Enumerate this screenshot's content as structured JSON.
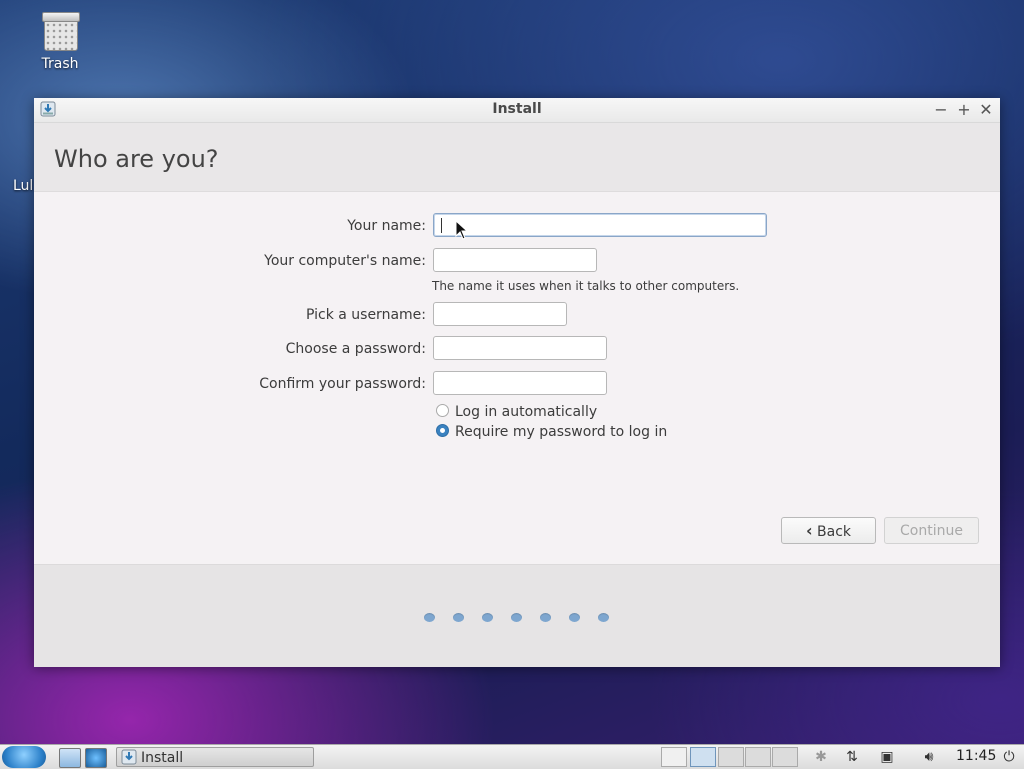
{
  "desktop": {
    "trash_label": "Trash",
    "side_label": "Lul"
  },
  "window": {
    "title": "Install",
    "controls": {
      "minimize": "−",
      "maximize": "+",
      "close": "✕"
    }
  },
  "page": {
    "title": "Who are you?"
  },
  "form": {
    "name": {
      "label": "Your name:",
      "value": ""
    },
    "computer_name": {
      "label": "Your computer's name:",
      "value": "",
      "hint": "The name it uses when it talks to other computers."
    },
    "username": {
      "label": "Pick a username:",
      "value": ""
    },
    "password": {
      "label": "Choose a password:",
      "value": ""
    },
    "confirm_password": {
      "label": "Confirm your password:",
      "value": ""
    },
    "login_options": [
      {
        "label": "Log in automatically",
        "checked": false
      },
      {
        "label": "Require my password to log in",
        "checked": true
      }
    ]
  },
  "buttons": {
    "back": "Back",
    "back_icon": "‹",
    "continue": "Continue"
  },
  "progress": {
    "total_steps": 7
  },
  "taskbar": {
    "task_label": "Install",
    "clock": "11:45",
    "icons": [
      "start-menu-icon",
      "file-manager-icon",
      "browser-icon",
      "bluetooth-icon",
      "network-icon",
      "display-icon",
      "volume-icon",
      "power-icon"
    ]
  },
  "colors": {
    "accent": "#3a82c0",
    "progress_dot": "#7ea6cf"
  }
}
